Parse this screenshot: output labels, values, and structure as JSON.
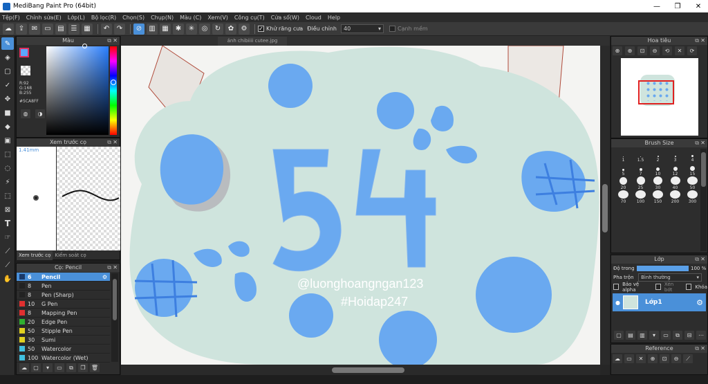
{
  "window": {
    "title": "MediBang Paint Pro (64bit)",
    "min": "—",
    "restore": "❐",
    "close": "✕"
  },
  "menu": [
    "Tệp(F)",
    "Chỉnh sửa(E)",
    "Lớp(L)",
    "Bộ lọc(R)",
    "Chọn(S)",
    "Chụp(N)",
    "Màu (C)",
    "Xem(V)",
    "Công cụ(T)",
    "Cửa sổ(W)",
    "Cloud",
    "Help"
  ],
  "toolbar": {
    "antialias_label": "Khử răng cưa",
    "adjust_label": "Điều chỉnh",
    "adjust_value": "40",
    "snap_label": "Cạnh mềm"
  },
  "color_panel": {
    "title": "Màu",
    "r": "R:92",
    "g": "G:168",
    "b": "B:255",
    "hex": "#5CA8FF",
    "accent": "#5CA8FF"
  },
  "brush_preview": {
    "title": "Xem trước cọ",
    "size": "1.41mm",
    "tab1": "Xem trước cọ",
    "tab2": "Kiểm soát cọ"
  },
  "brush_list": {
    "title": "Cọ: Pencil",
    "items": [
      {
        "num": "6",
        "name": "Pencil",
        "color": "#1a3a6a"
      },
      {
        "num": "8",
        "name": "Pen",
        "color": "#222222"
      },
      {
        "num": "8",
        "name": "Pen (Sharp)",
        "color": "#222222"
      },
      {
        "num": "10",
        "name": "G Pen",
        "color": "#e03030"
      },
      {
        "num": "8",
        "name": "Mapping Pen",
        "color": "#e03030"
      },
      {
        "num": "20",
        "name": "Edge Pen",
        "color": "#30b030"
      },
      {
        "num": "50",
        "name": "Stipple Pen",
        "color": "#e0d020"
      },
      {
        "num": "30",
        "name": "Sumi",
        "color": "#e0d020"
      },
      {
        "num": "50",
        "name": "Watercolor",
        "color": "#40c0e0"
      },
      {
        "num": "100",
        "name": "Watercolor (Wet)",
        "color": "#40c0e0"
      }
    ]
  },
  "canvas": {
    "tab": "ảnh chibiiii cutee.jpg",
    "watermark1": "@luonghoangngan123",
    "watermark2": "#Hoidap247"
  },
  "navigator": {
    "title": "Hoa tiêu"
  },
  "brush_size": {
    "title": "Brush Size",
    "sizes": [
      "1",
      "1.5",
      "2",
      "3",
      "4",
      "5",
      "7",
      "10",
      "12",
      "15",
      "20",
      "25",
      "30",
      "40",
      "50",
      "70",
      "100",
      "150",
      "200",
      "300"
    ],
    "dots": [
      1,
      1,
      2,
      2,
      3,
      3,
      4,
      5,
      6,
      7,
      11,
      12,
      13,
      14,
      15,
      15,
      15,
      15,
      15,
      15
    ]
  },
  "layer": {
    "title": "Lớp",
    "opacity_label": "Độ trong",
    "opacity_value": "100 %",
    "blend_label": "Pha trộn",
    "blend_value": "Bình thường",
    "protect_alpha": "Bảo vệ alpha",
    "clipping": "Xén bớt",
    "lock": "Khóa",
    "layer_name": "Lớp1"
  },
  "reference": {
    "title": "Reference"
  }
}
